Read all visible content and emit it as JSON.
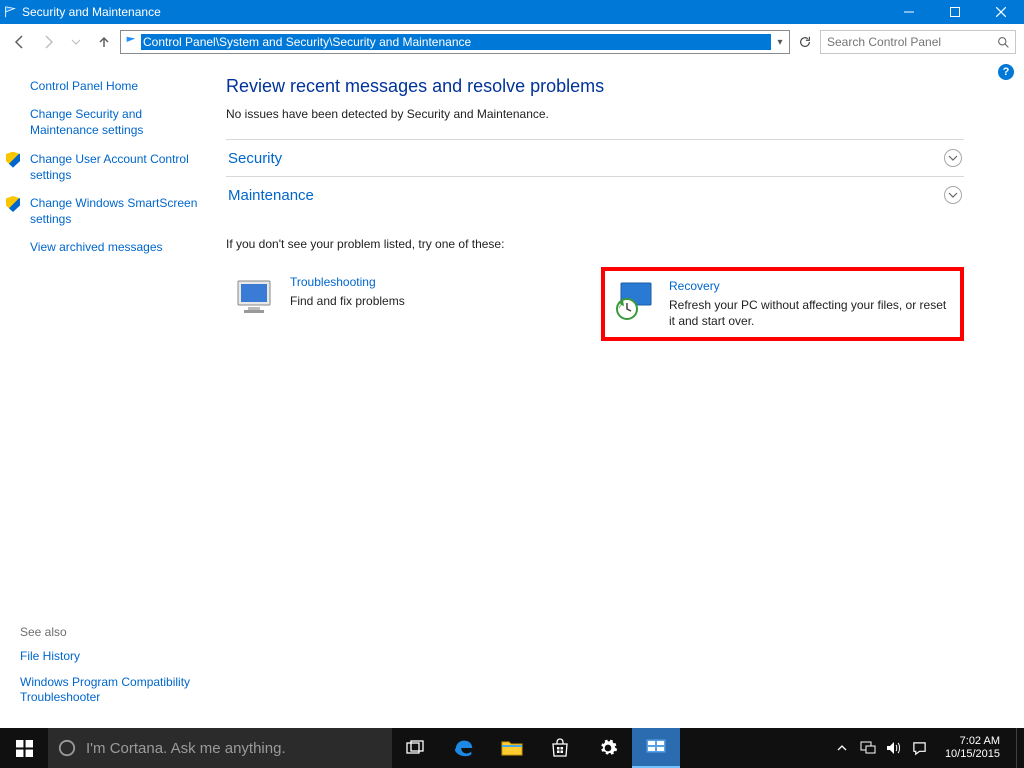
{
  "window": {
    "title": "Security and Maintenance"
  },
  "address": {
    "path": "Control Panel\\System and Security\\Security and Maintenance"
  },
  "search": {
    "placeholder": "Search Control Panel"
  },
  "sidebar": {
    "items": [
      {
        "label": "Control Panel Home",
        "shield": false
      },
      {
        "label": "Change Security and Maintenance settings",
        "shield": false
      },
      {
        "label": "Change User Account Control settings",
        "shield": true
      },
      {
        "label": "Change Windows SmartScreen settings",
        "shield": true
      },
      {
        "label": "View archived messages",
        "shield": false
      }
    ]
  },
  "seealso": {
    "header": "See also",
    "links": [
      {
        "label": "File History"
      },
      {
        "label": "Windows Program Compatibility Troubleshooter"
      }
    ]
  },
  "main": {
    "heading": "Review recent messages and resolve problems",
    "subtext": "No issues have been detected by Security and Maintenance.",
    "sections": [
      {
        "label": "Security"
      },
      {
        "label": "Maintenance"
      }
    ],
    "try_header": "If you don't see your problem listed, try one of these:",
    "tiles": [
      {
        "title": "Troubleshooting",
        "desc": "Find and fix problems",
        "highlight": false
      },
      {
        "title": "Recovery",
        "desc": "Refresh your PC without affecting your files, or reset it and start over.",
        "highlight": true
      }
    ]
  },
  "taskbar": {
    "search_placeholder": "I'm Cortana. Ask me anything.",
    "time": "7:02 AM",
    "date": "10/15/2015"
  }
}
